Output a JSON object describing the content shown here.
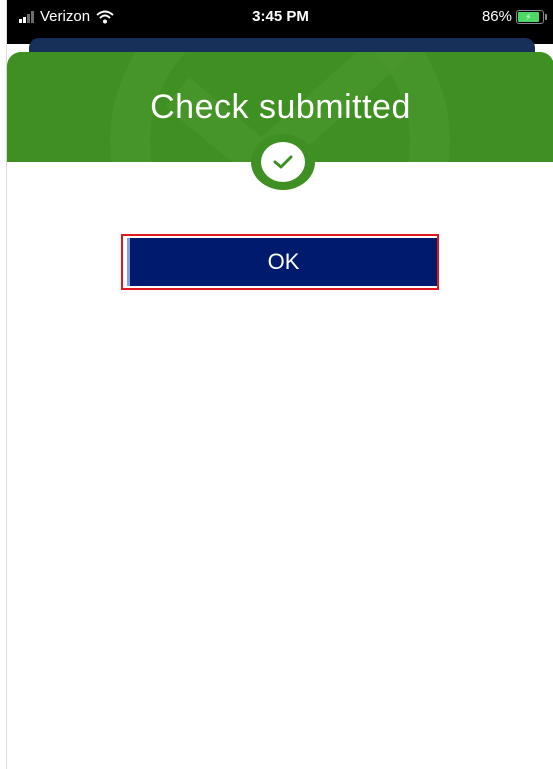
{
  "status_bar": {
    "carrier": "Verizon",
    "time": "3:45 PM",
    "battery_percent": "86%",
    "battery_level": 0.86
  },
  "header": {
    "title": "Check submitted"
  },
  "actions": {
    "ok_label": "OK"
  },
  "colors": {
    "header_green": "#3f9022",
    "button_navy": "#001a6e",
    "highlight_red": "#e0181e",
    "battery_green": "#4cd964"
  },
  "icons": {
    "signal": "signal-bars-icon",
    "wifi": "wifi-icon",
    "battery": "battery-charging-icon",
    "check": "checkmark-icon"
  }
}
